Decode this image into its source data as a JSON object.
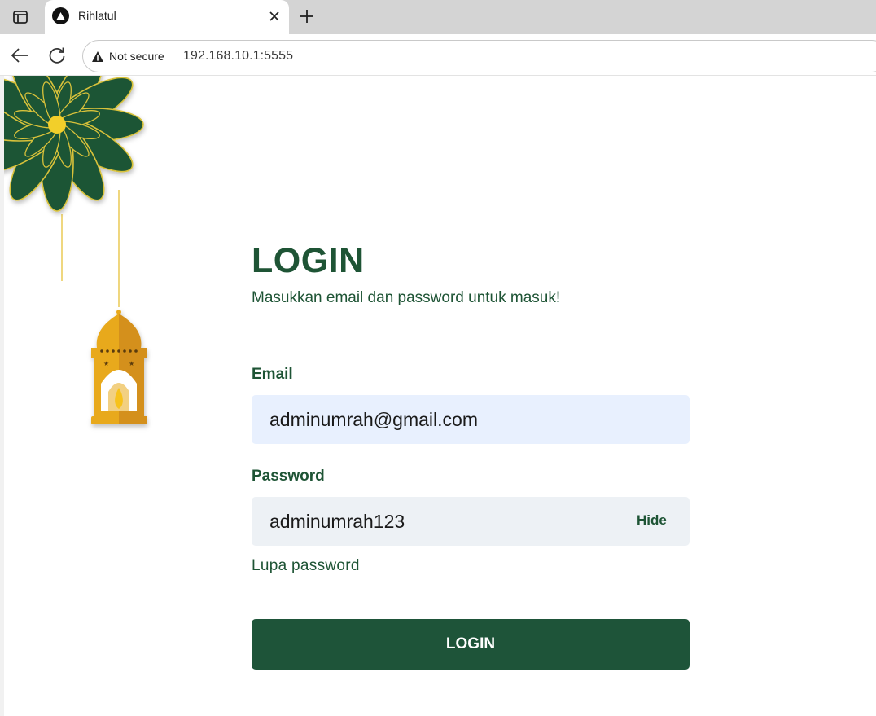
{
  "browser": {
    "tab_title": "Rihlatul",
    "security_label": "Not secure",
    "url": "192.168.10.1:5555"
  },
  "login": {
    "title": "LOGIN",
    "subtitle": "Masukkan email dan password untuk masuk!",
    "email_label": "Email",
    "email_value": "adminumrah@gmail.com",
    "password_label": "Password",
    "password_value": "adminumrah123",
    "password_toggle": "Hide",
    "forgot_link": "Lupa password",
    "submit_label": "LOGIN"
  },
  "colors": {
    "brand_green": "#1e5435",
    "gold": "#e8a91c",
    "email_fill": "#e8f0fe",
    "password_fill": "#edf1f5"
  }
}
